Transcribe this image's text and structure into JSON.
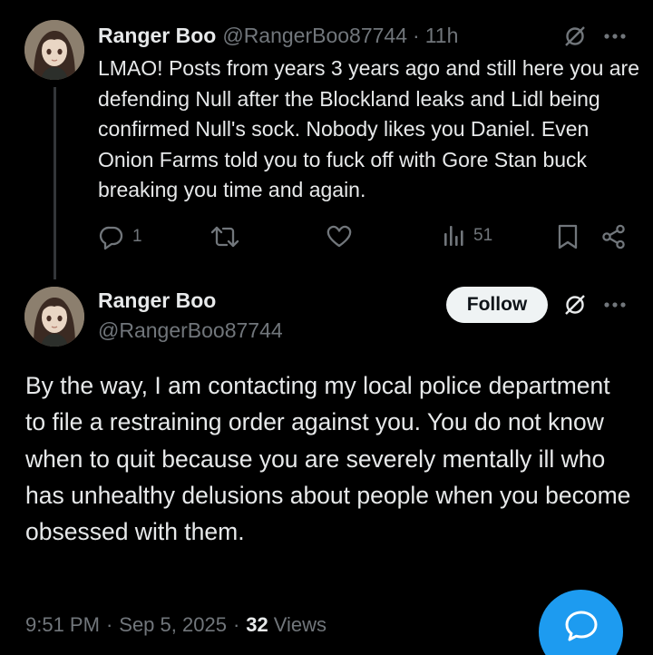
{
  "reply": {
    "author_name": "Ranger Boo",
    "author_handle": "@RangerBoo87744",
    "separator": "·",
    "time_ago": "11h",
    "body": "LMAO! Posts from years 3 years ago and still here you are defending Null after the Blockland leaks and Lidl being confirmed Null's sock. Nobody likes you Daniel. Even Onion Farms told you to fuck off with Gore Stan buck breaking you time and again.",
    "actions": {
      "reply_count": "1",
      "repost_count": "",
      "like_count": "",
      "views_count": "51"
    }
  },
  "main_post": {
    "author_name": "Ranger Boo",
    "author_handle": "@RangerBoo87744",
    "follow_label": "Follow",
    "body": "By the way, I am contacting my local police department to file a restraining order against you. You do not know when to quit because you are severely mentally ill who has unhealthy delusions about people when you become obsessed with them.",
    "time": "9:51 PM",
    "separator": "·",
    "date": "Sep 5, 2025",
    "views_count": "32",
    "views_label": "Views"
  },
  "icons": {
    "grok": "grok-icon",
    "more": "more-icon",
    "reply": "reply-icon",
    "repost": "repost-icon",
    "like": "like-icon",
    "analytics": "analytics-icon",
    "bookmark": "bookmark-icon",
    "share": "share-icon",
    "compose": "compose-reply-icon"
  },
  "colors": {
    "background": "#000000",
    "text": "#e7e9ea",
    "muted": "#71767b",
    "accent": "#1d9bf0",
    "follow_bg": "#eff3f4",
    "thread_line": "#333639"
  }
}
